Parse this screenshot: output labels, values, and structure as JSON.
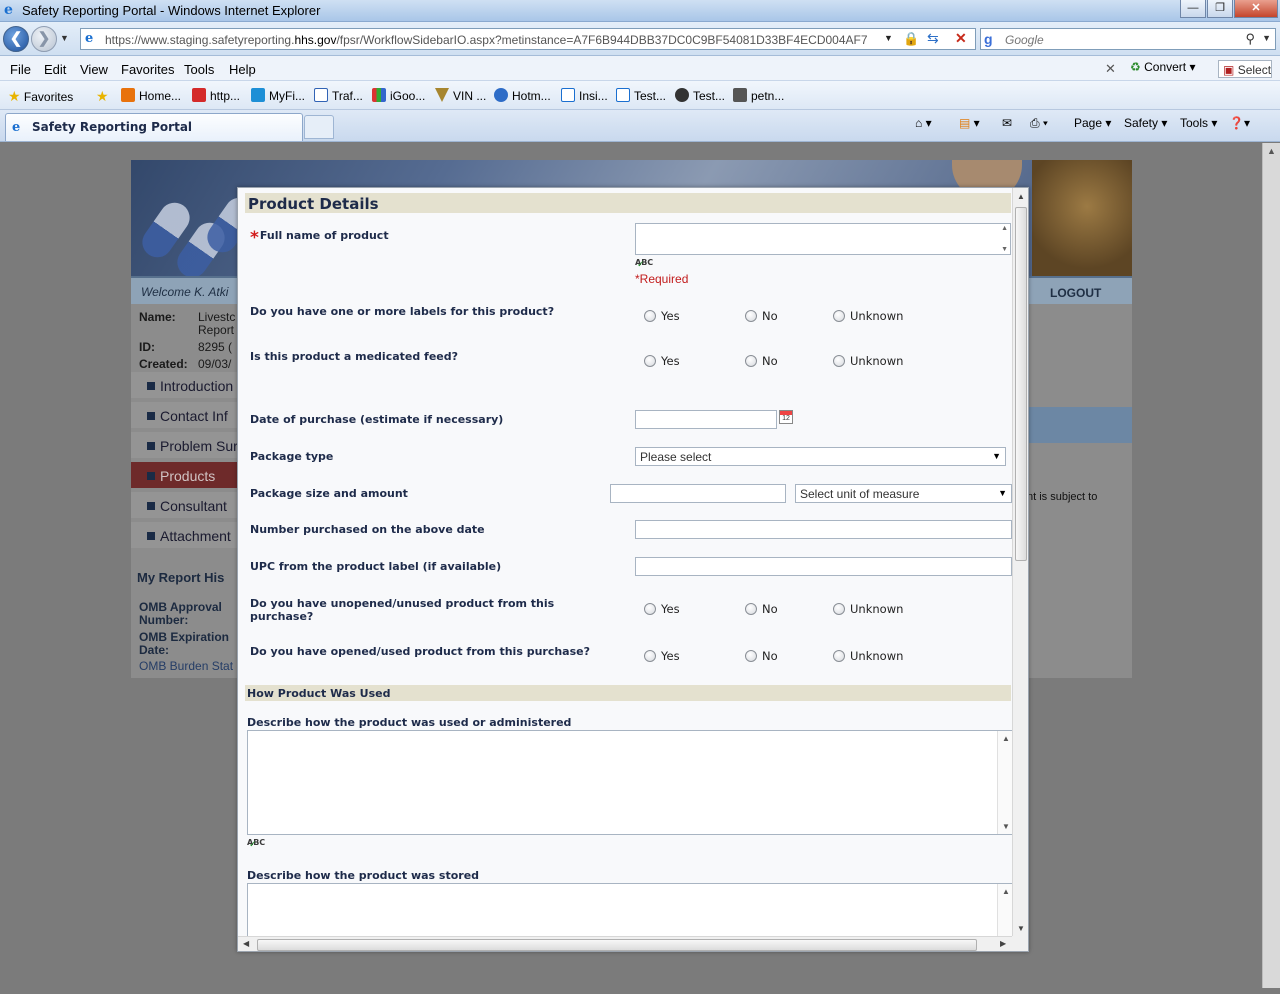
{
  "browser": {
    "window_title": "Safety Reporting Portal - Windows Internet Explorer",
    "url_prefix": "https://www.staging.safetyreporting.",
    "url_domain": "hhs.gov",
    "url_suffix": "/fpsr/WorkflowSidebarIO.aspx?metinstance=A7F6B944DBB37DC0C9BF54081D33BF4ECD004AF7",
    "search_placeholder": "Google",
    "menu": [
      "File",
      "Edit",
      "View",
      "Favorites",
      "Tools",
      "Help"
    ],
    "convert_label": "Convert",
    "select_label": "Select",
    "favorites_label": "Favorites",
    "favorites": [
      "Home...",
      "http...",
      "MyFi...",
      "Traf...",
      "iGoo...",
      "VIN ...",
      "Hotm...",
      "Insi...",
      "Test...",
      "Test...",
      "petn..."
    ],
    "tab_title": "Safety Reporting Portal",
    "command_bar": [
      "Page",
      "Safety",
      "Tools"
    ]
  },
  "page": {
    "welcome": "Welcome K. Atki",
    "logout": "LOGOUT",
    "info": {
      "name_label": "Name:",
      "name_value": "Livestc",
      "name_value2": "Report",
      "id_label": "ID:",
      "id_value": "8295 (",
      "created_label": "Created:",
      "created_value": "09/03/"
    },
    "nav": [
      "Introduction",
      "Contact Inf",
      "Problem Sur",
      "Products",
      "Consultant",
      "Attachment"
    ],
    "my_report": "My Report His",
    "omb": {
      "approval1": "OMB Approval",
      "approval2": "Number:",
      "expiration1": "OMB Expiration",
      "expiration2": "Date:",
      "burden": "OMB Burden Stat"
    },
    "subject_text": "nt is subject to"
  },
  "modal": {
    "section_title": "Product Details",
    "full_name_label": "Full name of product",
    "required_text": "*Required",
    "spell_label": "ABC",
    "q_labels": "Do you have one or more labels for this product?",
    "q_medicated": "Is this product a medicated feed?",
    "purchase_date_label": "Date of purchase (estimate if necessary)",
    "package_type_label": "Package type",
    "package_type_value": "Please select",
    "package_size_label": "Package size and amount",
    "unit_value": "Select unit of measure",
    "number_purchased_label": "Number purchased on the above date",
    "upc_label": "UPC from the product label (if available)",
    "q_unopened_1": "Do you have unopened/unused product from this",
    "q_unopened_2": "purchase?",
    "q_opened": "Do you have opened/used product from this purchase?",
    "radio_options": {
      "yes": "Yes",
      "no": "No",
      "unknown": "Unknown"
    },
    "usage_section": "How Product Was Used",
    "describe_used_label": "Describe how the product was used or administered",
    "describe_stored_label": "Describe how the product was stored"
  }
}
